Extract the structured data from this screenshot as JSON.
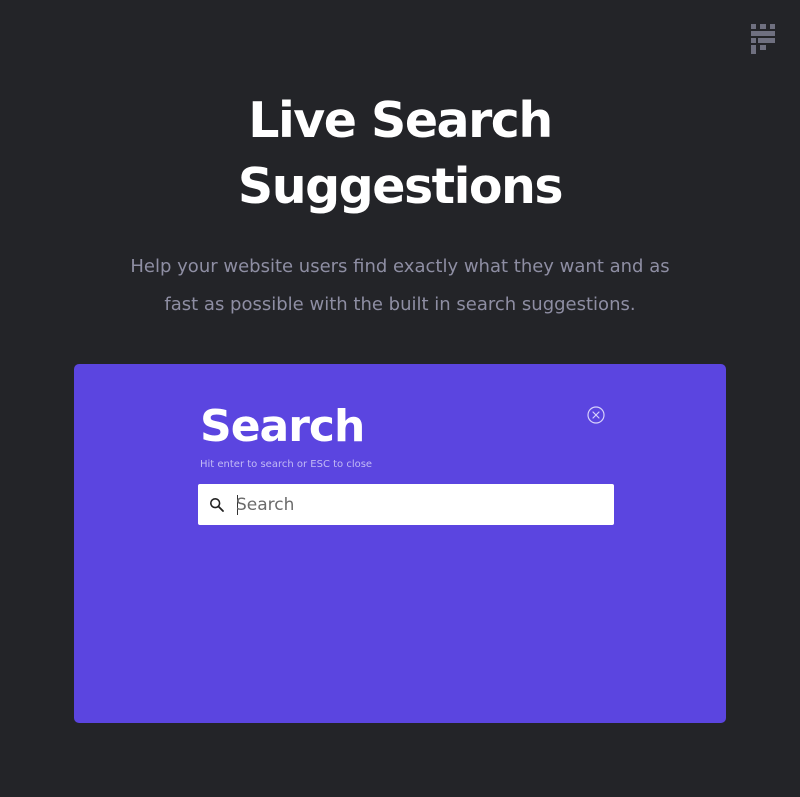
{
  "hero": {
    "title_line1": "Live Search",
    "title_line2": "Suggestions",
    "subtitle_line1": "Help your website users find exactly what they want and as",
    "subtitle_line2": "fast as possible with the built in search suggestions."
  },
  "search_modal": {
    "heading": "Search",
    "hint": "Hit enter to search or ESC to close",
    "input_placeholder": "Search",
    "input_value": ""
  },
  "icons": {
    "logo": "castle-logo-icon",
    "close": "close-circle-icon",
    "search": "search-icon"
  },
  "colors": {
    "page_background": "#232428",
    "panel_background": "#5b45e0",
    "title_text": "#ffffff",
    "subtitle_text": "#8e8ea3",
    "hint_text": "#c2baf5"
  }
}
